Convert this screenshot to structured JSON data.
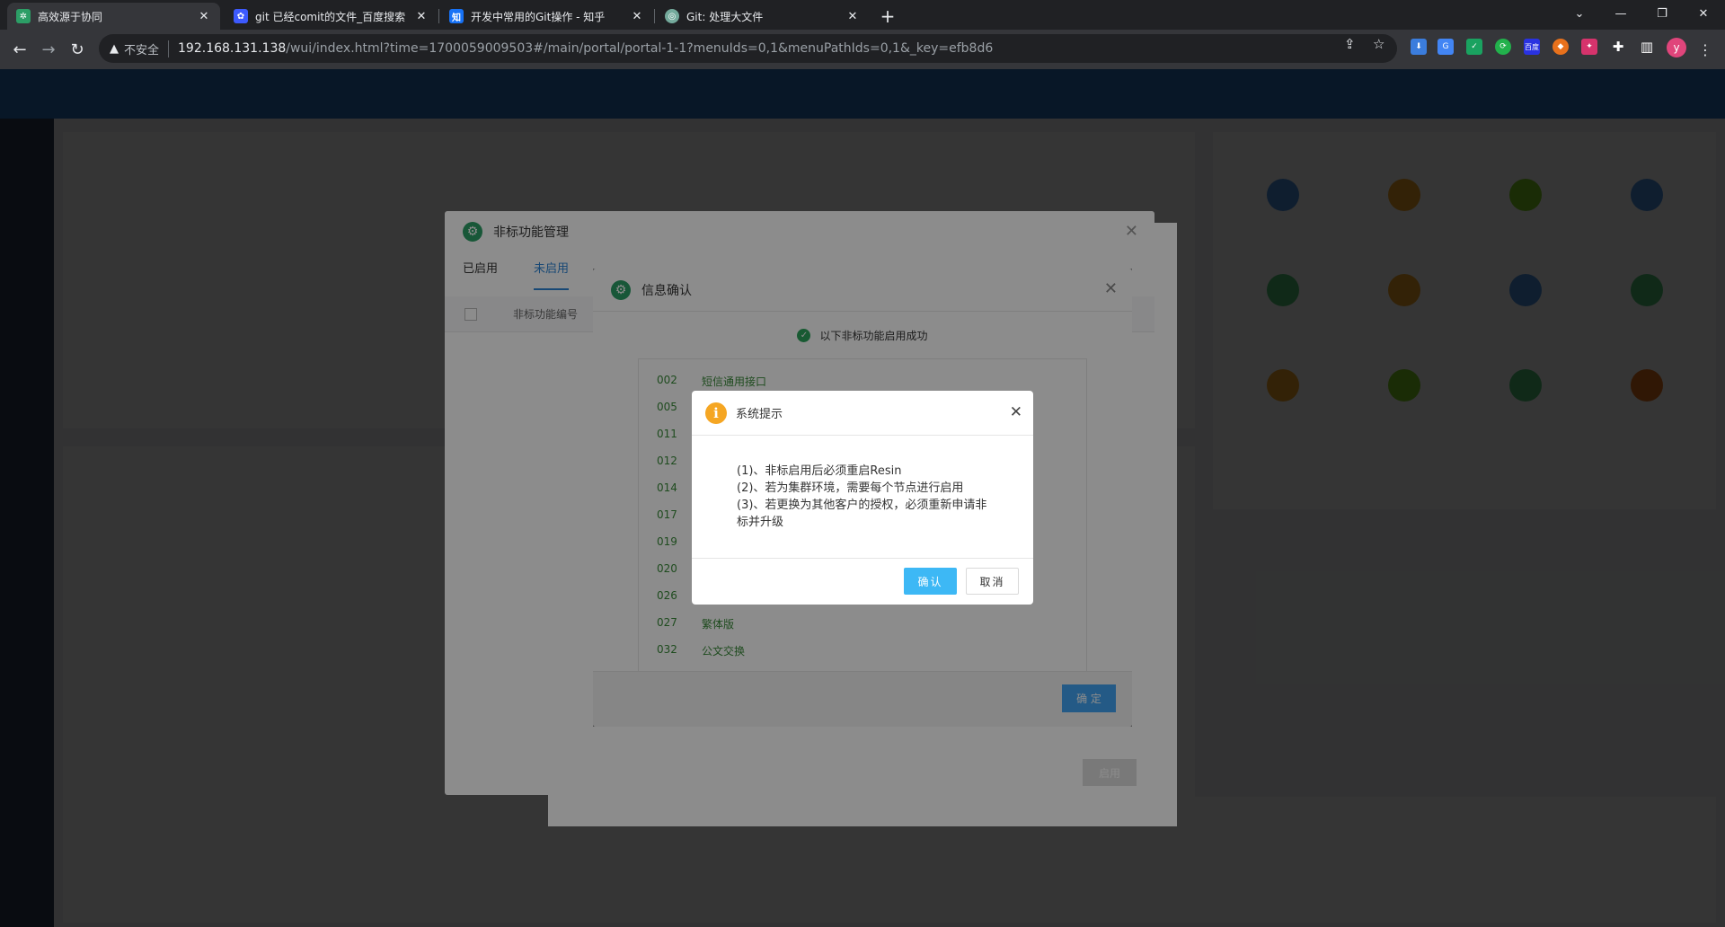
{
  "browser": {
    "tabs": [
      {
        "title": "高效源于协同",
        "favicon": "green-grid-icon",
        "color": "#2c9e66"
      },
      {
        "title": "git 已经comit的文件_百度搜索",
        "favicon": "baidu-paw-icon",
        "color": "#3d5afe"
      },
      {
        "title": "开发中常用的Git操作 - 知乎",
        "favicon": "zhihu-icon",
        "color": "#1772f6"
      },
      {
        "title": "Git: 处理大文件",
        "favicon": "chatgpt-icon",
        "color": "#74aa9c"
      }
    ],
    "address": {
      "insecure_label": "不安全",
      "host": "192.168.131.138",
      "path": "/wui/index.html?time=1700059009503#/main/portal/portal-1-1?menuIds=0,1&menuPathIds=0,1&_key=efb8d6"
    },
    "avatar_letter": "y",
    "ext_baidu_label": "百度"
  },
  "dialog_manage": {
    "title": "非标功能管理",
    "tabs": [
      "已启用",
      "未启用"
    ],
    "column_header": "非标功能编号",
    "enable_button": "启用"
  },
  "dialog_info": {
    "title": "信息确认",
    "success_message": "以下非标功能启用成功",
    "items": [
      {
        "code": "002",
        "name": "短信通用接口"
      },
      {
        "code": "005",
        "name": ""
      },
      {
        "code": "011",
        "name": ""
      },
      {
        "code": "012",
        "name": ""
      },
      {
        "code": "014",
        "name": ""
      },
      {
        "code": "017",
        "name": ""
      },
      {
        "code": "019",
        "name": ""
      },
      {
        "code": "020",
        "name": ""
      },
      {
        "code": "026",
        "name": ""
      },
      {
        "code": "027",
        "name": "繁体版"
      },
      {
        "code": "032",
        "name": "公文交换"
      }
    ],
    "ok_button": "确 定"
  },
  "dialog_prompt": {
    "title": "系统提示",
    "lines": [
      "(1)、非标启用后必须重启Resin",
      "(2)、若为集群环境，需要每个节点进行启用",
      "(3)、若更换为其他客户的授权，必须重新申请非标并升级"
    ],
    "confirm_button": "确认",
    "cancel_button": "取消"
  }
}
